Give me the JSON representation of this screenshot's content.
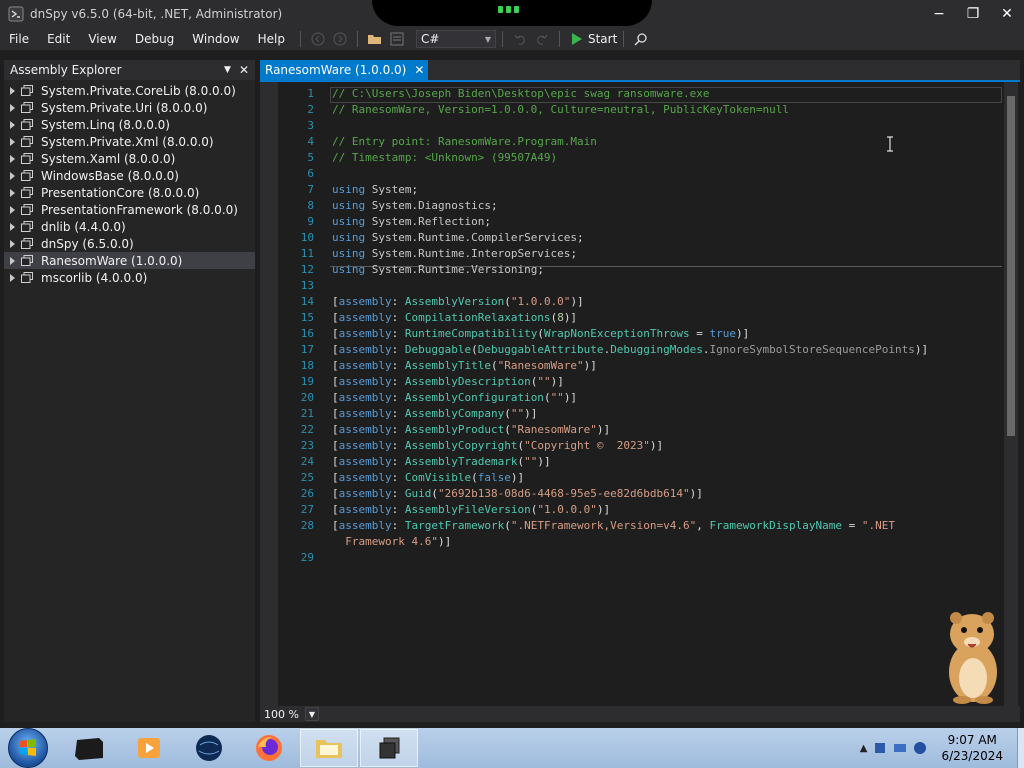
{
  "window": {
    "title": "dnSpy v6.5.0 (64-bit, .NET, Administrator)",
    "minimize": "−",
    "maximize": "❐",
    "close": "✕"
  },
  "menu": [
    "File",
    "Edit",
    "View",
    "Debug",
    "Window",
    "Help"
  ],
  "toolbar": {
    "language": "C#",
    "start_label": "Start"
  },
  "explorer": {
    "title": "Assembly Explorer",
    "close": "✕",
    "items": [
      {
        "label": "System.Private.CoreLib (8.0.0.0)",
        "selected": false
      },
      {
        "label": "System.Private.Uri (8.0.0.0)",
        "selected": false
      },
      {
        "label": "System.Linq (8.0.0.0)",
        "selected": false
      },
      {
        "label": "System.Private.Xml (8.0.0.0)",
        "selected": false
      },
      {
        "label": "System.Xaml (8.0.0.0)",
        "selected": false
      },
      {
        "label": "WindowsBase (8.0.0.0)",
        "selected": false
      },
      {
        "label": "PresentationCore (8.0.0.0)",
        "selected": false
      },
      {
        "label": "PresentationFramework (8.0.0.0)",
        "selected": false
      },
      {
        "label": "dnlib (4.4.0.0)",
        "selected": false
      },
      {
        "label": "dnSpy (6.5.0.0)",
        "selected": false
      },
      {
        "label": "RanesomWare (1.0.0.0)",
        "selected": true
      },
      {
        "label": "mscorlib (4.0.0.0)",
        "selected": false
      }
    ]
  },
  "editor": {
    "tab_label": "RanesomWare (1.0.0.0)",
    "tab_close": "✕",
    "zoom": "100 %",
    "lines": [
      {
        "n": "1",
        "tokens": [
          [
            "cm",
            "// C:\\Users\\Joseph Biden\\Desktop\\epic swag ransomware.exe"
          ]
        ]
      },
      {
        "n": "2",
        "tokens": [
          [
            "cm",
            "// RanesomWare, Version=1.0.0.0, Culture=neutral, PublicKeyToken=null"
          ]
        ]
      },
      {
        "n": "3",
        "tokens": []
      },
      {
        "n": "4",
        "tokens": [
          [
            "cm",
            "// Entry point: RanesomWare.Program.Main"
          ]
        ]
      },
      {
        "n": "5",
        "tokens": [
          [
            "cm",
            "// Timestamp: <Unknown> (99507A49)"
          ]
        ]
      },
      {
        "n": "6",
        "tokens": []
      },
      {
        "n": "7",
        "tokens": [
          [
            "kw",
            "using"
          ],
          [
            "ns",
            " System"
          ],
          [
            "",
            ";"
          ]
        ]
      },
      {
        "n": "8",
        "tokens": [
          [
            "kw",
            "using"
          ],
          [
            "ns",
            " System.Diagnostics"
          ],
          [
            "",
            ";"
          ]
        ]
      },
      {
        "n": "9",
        "tokens": [
          [
            "kw",
            "using"
          ],
          [
            "ns",
            " System.Reflection"
          ],
          [
            "",
            ";"
          ]
        ]
      },
      {
        "n": "10",
        "tokens": [
          [
            "kw",
            "using"
          ],
          [
            "ns",
            " System.Runtime.CompilerServices"
          ],
          [
            "",
            ";"
          ]
        ]
      },
      {
        "n": "11",
        "tokens": [
          [
            "kw",
            "using"
          ],
          [
            "ns",
            " System.Runtime.InteropServices"
          ],
          [
            "",
            ";"
          ]
        ]
      },
      {
        "n": "12",
        "tokens": [
          [
            "kw",
            "using"
          ],
          [
            "ns",
            " System.Runtime.Versioning"
          ],
          [
            "",
            ";"
          ]
        ]
      },
      {
        "n": "13",
        "tokens": []
      },
      {
        "n": "14",
        "tokens": [
          [
            "",
            "["
          ],
          [
            "kw",
            "assembly"
          ],
          [
            "",
            ": "
          ],
          [
            "ty",
            "AssemblyVersion"
          ],
          [
            "",
            "("
          ],
          [
            "st",
            "\"1.0.0.0\""
          ],
          [
            "",
            ")]"
          ]
        ]
      },
      {
        "n": "15",
        "tokens": [
          [
            "",
            "["
          ],
          [
            "kw",
            "assembly"
          ],
          [
            "",
            ": "
          ],
          [
            "ty",
            "CompilationRelaxations"
          ],
          [
            "",
            "("
          ],
          [
            "nm",
            "8"
          ],
          [
            "",
            ")]"
          ]
        ]
      },
      {
        "n": "16",
        "tokens": [
          [
            "",
            "["
          ],
          [
            "kw",
            "assembly"
          ],
          [
            "",
            ": "
          ],
          [
            "ty",
            "RuntimeCompatibility"
          ],
          [
            "",
            "("
          ],
          [
            "ty",
            "WrapNonExceptionThrows"
          ],
          [
            "",
            " = "
          ],
          [
            "kw",
            "true"
          ],
          [
            "",
            ")]"
          ]
        ]
      },
      {
        "n": "17",
        "tokens": [
          [
            "",
            "["
          ],
          [
            "kw",
            "assembly"
          ],
          [
            "",
            ": "
          ],
          [
            "ty",
            "Debuggable"
          ],
          [
            "",
            "("
          ],
          [
            "ty",
            "DebuggableAttribute"
          ],
          [
            "",
            "."
          ],
          [
            "ty",
            "DebuggingModes"
          ],
          [
            "",
            "."
          ],
          [
            "pr",
            "IgnoreSymbolStoreSequencePoints"
          ],
          [
            "",
            ")]"
          ]
        ]
      },
      {
        "n": "18",
        "tokens": [
          [
            "",
            "["
          ],
          [
            "kw",
            "assembly"
          ],
          [
            "",
            ": "
          ],
          [
            "ty",
            "AssemblyTitle"
          ],
          [
            "",
            "("
          ],
          [
            "st",
            "\"RanesomWare\""
          ],
          [
            "",
            ")]"
          ]
        ]
      },
      {
        "n": "19",
        "tokens": [
          [
            "",
            "["
          ],
          [
            "kw",
            "assembly"
          ],
          [
            "",
            ": "
          ],
          [
            "ty",
            "AssemblyDescription"
          ],
          [
            "",
            "("
          ],
          [
            "st",
            "\"\""
          ],
          [
            "",
            ")]"
          ]
        ]
      },
      {
        "n": "20",
        "tokens": [
          [
            "",
            "["
          ],
          [
            "kw",
            "assembly"
          ],
          [
            "",
            ": "
          ],
          [
            "ty",
            "AssemblyConfiguration"
          ],
          [
            "",
            "("
          ],
          [
            "st",
            "\"\""
          ],
          [
            "",
            ")]"
          ]
        ]
      },
      {
        "n": "21",
        "tokens": [
          [
            "",
            "["
          ],
          [
            "kw",
            "assembly"
          ],
          [
            "",
            ": "
          ],
          [
            "ty",
            "AssemblyCompany"
          ],
          [
            "",
            "("
          ],
          [
            "st",
            "\"\""
          ],
          [
            "",
            ")]"
          ]
        ]
      },
      {
        "n": "22",
        "tokens": [
          [
            "",
            "["
          ],
          [
            "kw",
            "assembly"
          ],
          [
            "",
            ": "
          ],
          [
            "ty",
            "AssemblyProduct"
          ],
          [
            "",
            "("
          ],
          [
            "st",
            "\"RanesomWare\""
          ],
          [
            "",
            ")]"
          ]
        ]
      },
      {
        "n": "23",
        "tokens": [
          [
            "",
            "["
          ],
          [
            "kw",
            "assembly"
          ],
          [
            "",
            ": "
          ],
          [
            "ty",
            "AssemblyCopyright"
          ],
          [
            "",
            "("
          ],
          [
            "st",
            "\"Copyright ©  2023\""
          ],
          [
            "",
            ")]"
          ]
        ]
      },
      {
        "n": "24",
        "tokens": [
          [
            "",
            "["
          ],
          [
            "kw",
            "assembly"
          ],
          [
            "",
            ": "
          ],
          [
            "ty",
            "AssemblyTrademark"
          ],
          [
            "",
            "("
          ],
          [
            "st",
            "\"\""
          ],
          [
            "",
            ")]"
          ]
        ]
      },
      {
        "n": "25",
        "tokens": [
          [
            "",
            "["
          ],
          [
            "kw",
            "assembly"
          ],
          [
            "",
            ": "
          ],
          [
            "ty",
            "ComVisible"
          ],
          [
            "",
            "("
          ],
          [
            "kw",
            "false"
          ],
          [
            "",
            ")]"
          ]
        ]
      },
      {
        "n": "26",
        "tokens": [
          [
            "",
            "["
          ],
          [
            "kw",
            "assembly"
          ],
          [
            "",
            ": "
          ],
          [
            "ty",
            "Guid"
          ],
          [
            "",
            "("
          ],
          [
            "st",
            "\"2692b138-08d6-4468-95e5-ee82d6bdb614\""
          ],
          [
            "",
            ")]"
          ]
        ]
      },
      {
        "n": "27",
        "tokens": [
          [
            "",
            "["
          ],
          [
            "kw",
            "assembly"
          ],
          [
            "",
            ": "
          ],
          [
            "ty",
            "AssemblyFileVersion"
          ],
          [
            "",
            "("
          ],
          [
            "st",
            "\"1.0.0.0\""
          ],
          [
            "",
            ")]"
          ]
        ]
      },
      {
        "n": "28",
        "tokens": [
          [
            "",
            "["
          ],
          [
            "kw",
            "assembly"
          ],
          [
            "",
            ": "
          ],
          [
            "ty",
            "TargetFramework"
          ],
          [
            "",
            "("
          ],
          [
            "st",
            "\".NETFramework,Version=v4.6\""
          ],
          [
            "",
            ", "
          ],
          [
            "ty",
            "FrameworkDisplayName"
          ],
          [
            "",
            " = "
          ],
          [
            "st",
            "\".NET"
          ]
        ]
      },
      {
        "n": "",
        "tokens": [
          [
            "st",
            "  Framework 4.6\""
          ],
          [
            "",
            ")]"
          ]
        ]
      },
      {
        "n": "29",
        "tokens": []
      }
    ]
  },
  "taskbar": {
    "time": "9:07 AM",
    "date": "6/23/2024",
    "apps": [
      "terminal-app",
      "media-player-app",
      "globe-app",
      "firefox-app",
      "explorer-app",
      "windows-app"
    ]
  },
  "colors": {
    "accent": "#007acc",
    "start_green": "#3ab549"
  }
}
